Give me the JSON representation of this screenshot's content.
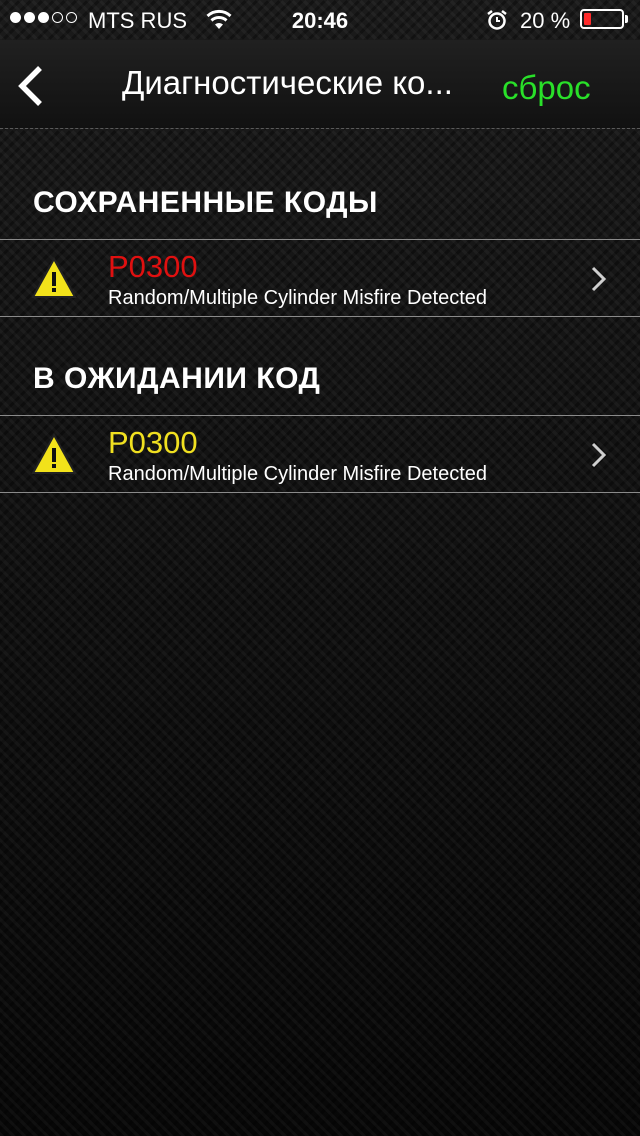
{
  "status_bar": {
    "carrier": "MTS RUS",
    "time": "20:46",
    "battery_percent_label": "20 %",
    "battery_level": 0.2,
    "signal_bars_filled": 3,
    "signal_bars_total": 5,
    "battery_color": "#ff2b2b"
  },
  "nav": {
    "title": "Диагностические ко...",
    "reset_label": "сброс",
    "reset_color": "#29e029",
    "back_icon": "chevron-left-icon"
  },
  "sections": [
    {
      "header": "СОХРАНЕННЫЕ КОДЫ",
      "items": [
        {
          "code": "P0300",
          "code_color": "#e01010",
          "description": "Random/Multiple Cylinder Misfire Detected",
          "icon": "warning-icon"
        }
      ]
    },
    {
      "header": "В ОЖИДАНИИ КОД",
      "items": [
        {
          "code": "P0300",
          "code_color": "#f0e020",
          "description": "Random/Multiple Cylinder Misfire Detected",
          "icon": "warning-icon"
        }
      ]
    }
  ]
}
